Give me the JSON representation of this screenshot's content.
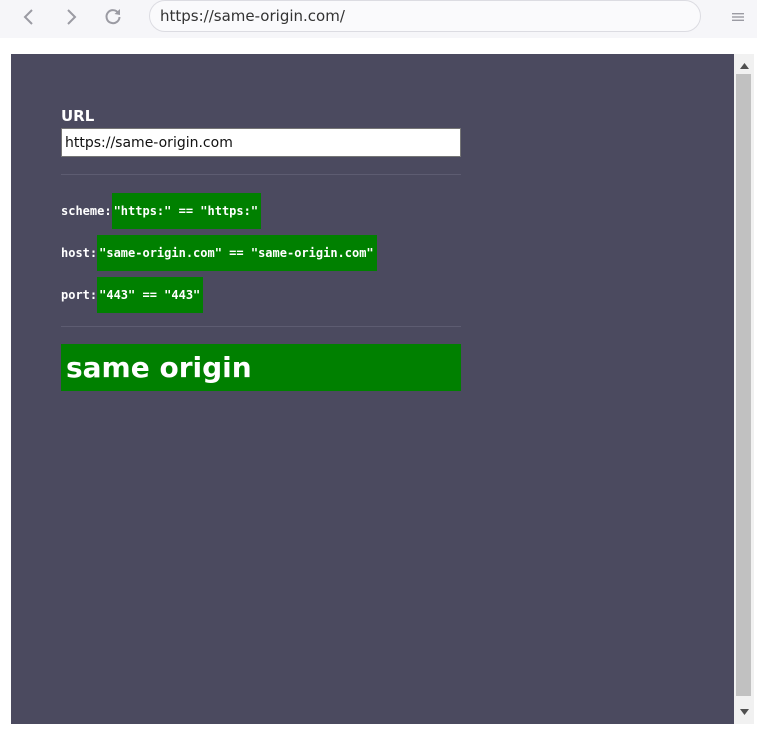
{
  "browser": {
    "address": "https://same-origin.com/",
    "icons": {
      "back": "chevron-left-icon",
      "forward": "chevron-right-icon",
      "reload": "reload-icon",
      "menu": "hamburger-menu-icon"
    },
    "colors": {
      "toolbar": "#f6f6f9",
      "icon": "#9b9ba3"
    }
  },
  "page": {
    "url_label": "URL",
    "url_value": "https://same-origin.com",
    "checks": [
      {
        "label": "scheme: ",
        "value": "\"https:\" == \"https:\"",
        "match": true
      },
      {
        "label": "host: ",
        "value": "\"same-origin.com\" == \"same-origin.com\"",
        "match": true
      },
      {
        "label": "port: ",
        "value": "\"443\" == \"443\"",
        "match": true
      }
    ],
    "result": "same origin",
    "colors": {
      "background": "#4b4a5f",
      "match": "#008000",
      "text": "#ffffff"
    }
  }
}
